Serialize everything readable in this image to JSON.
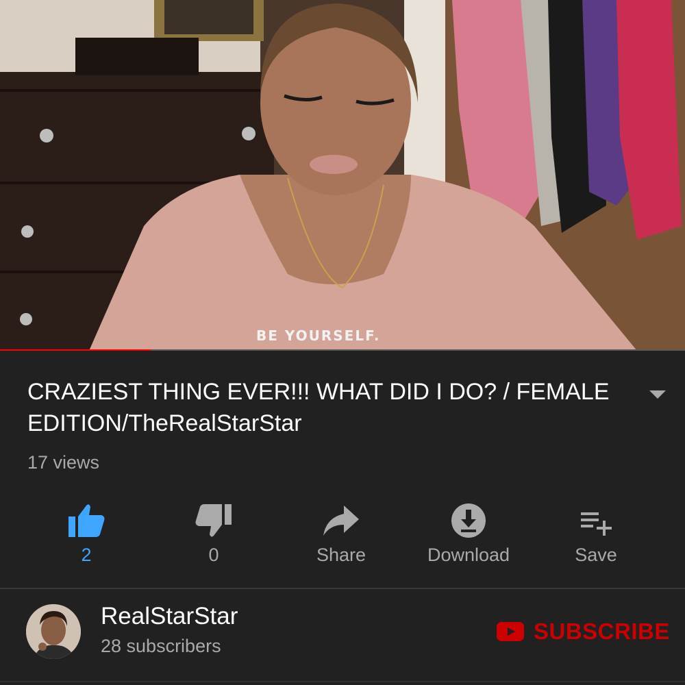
{
  "video": {
    "shirt_text": "BE YOURSELF.",
    "progress_fraction": 0.22
  },
  "title": "CRAZIEST THING EVER!!! WHAT DID I DO? / FEMALE EDITION/TheRealStarStar",
  "views": "17 views",
  "actions": [
    {
      "icon": "thumbs-up-icon",
      "label": "2",
      "color": "#3ea6ff"
    },
    {
      "icon": "thumbs-down-icon",
      "label": "0",
      "color": "#aaaaaa"
    },
    {
      "icon": "share-icon",
      "label": "Share",
      "color": "#aaaaaa"
    },
    {
      "icon": "download-icon",
      "label": "Download",
      "color": "#aaaaaa"
    },
    {
      "icon": "add-to-playlist-icon",
      "label": "Save",
      "color": "#aaaaaa"
    }
  ],
  "channel": {
    "name": "RealStarStar",
    "subscribers": "28 subscribers",
    "subscribe_label": "SUBSCRIBE"
  },
  "colors": {
    "background": "#212121",
    "accent_red": "#cc0000",
    "like_blue": "#3ea6ff",
    "secondary_text": "#aaaaaa"
  }
}
